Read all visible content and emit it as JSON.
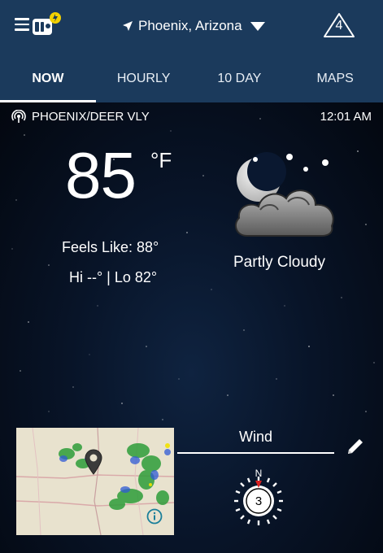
{
  "header": {
    "location": "Phoenix, Arizona",
    "alerts_count": "4"
  },
  "tabs": [
    {
      "label": "NOW",
      "active": true
    },
    {
      "label": "HOURLY",
      "active": false
    },
    {
      "label": "10 DAY",
      "active": false
    },
    {
      "label": "MAPS",
      "active": false
    }
  ],
  "station": {
    "name": "PHOENIX/DEER VLY",
    "time": "12:01 AM"
  },
  "current": {
    "temperature": "85",
    "unit": "°F",
    "feels_like": "Feels Like: 88°",
    "hi_lo": "Hi --° | Lo 82°",
    "condition": "Partly Cloudy",
    "icon": "partly-cloudy-night-icon"
  },
  "wind": {
    "title": "Wind",
    "speed": "3",
    "direction": "N"
  },
  "colors": {
    "header_bg": "#1b3a5c",
    "sky_dark": "#03070f",
    "alert_badge": "#f2d000"
  }
}
